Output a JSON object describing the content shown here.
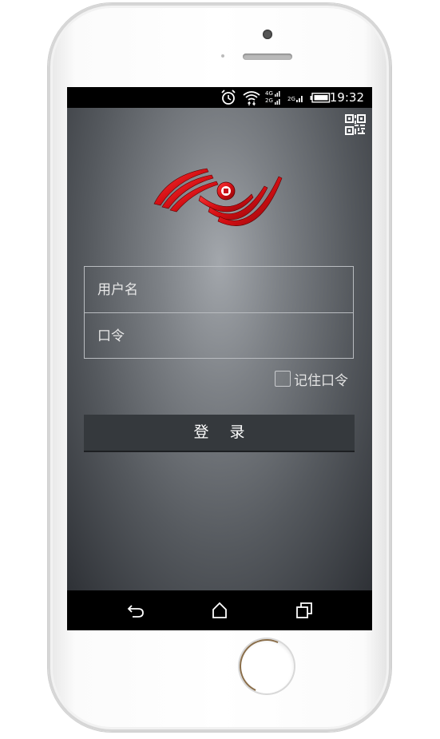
{
  "statusbar": {
    "time": "19:32",
    "icons": [
      "alarm-icon",
      "wifi-icon",
      "4g-signal-icon",
      "2g-signal-icon",
      "battery-icon"
    ],
    "net_top": "4G",
    "net_bottom": "2G",
    "net_2g": "2G"
  },
  "login": {
    "username_placeholder": "用户名",
    "password_placeholder": "口令",
    "remember_label": "记住口令",
    "login_label": "登录"
  },
  "navbar": {
    "icons": [
      "back-icon",
      "home-icon",
      "recent-apps-icon"
    ]
  },
  "colors": {
    "accent": "#d4141a",
    "button_bg": "#35393d"
  }
}
